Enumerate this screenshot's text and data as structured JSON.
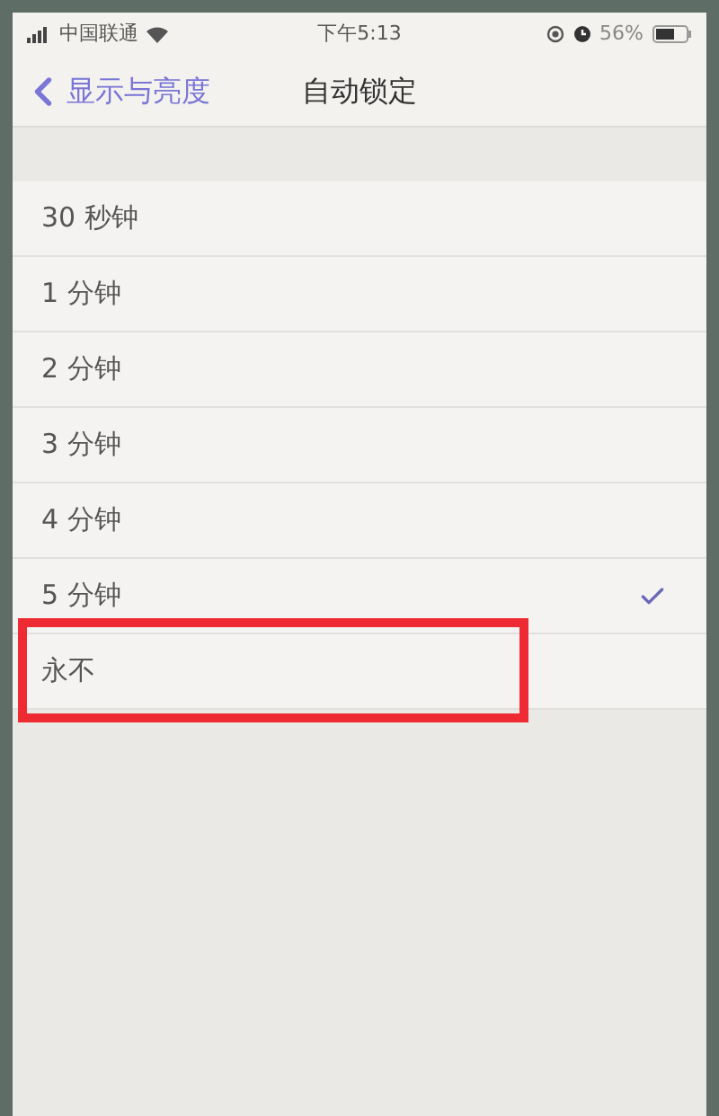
{
  "status_bar": {
    "carrier": "中国联通",
    "time": "下午5:13",
    "battery": "56%"
  },
  "nav": {
    "back": "显示与亮度",
    "title": "自动锁定"
  },
  "options": [
    {
      "label": "30 秒钟",
      "selected": false,
      "highlighted": false
    },
    {
      "label": "1 分钟",
      "selected": false,
      "highlighted": false
    },
    {
      "label": "2 分钟",
      "selected": false,
      "highlighted": false
    },
    {
      "label": "3 分钟",
      "selected": false,
      "highlighted": false
    },
    {
      "label": "4 分钟",
      "selected": false,
      "highlighted": false
    },
    {
      "label": "5 分钟",
      "selected": true,
      "highlighted": false
    },
    {
      "label": "永不",
      "selected": false,
      "highlighted": true
    }
  ]
}
